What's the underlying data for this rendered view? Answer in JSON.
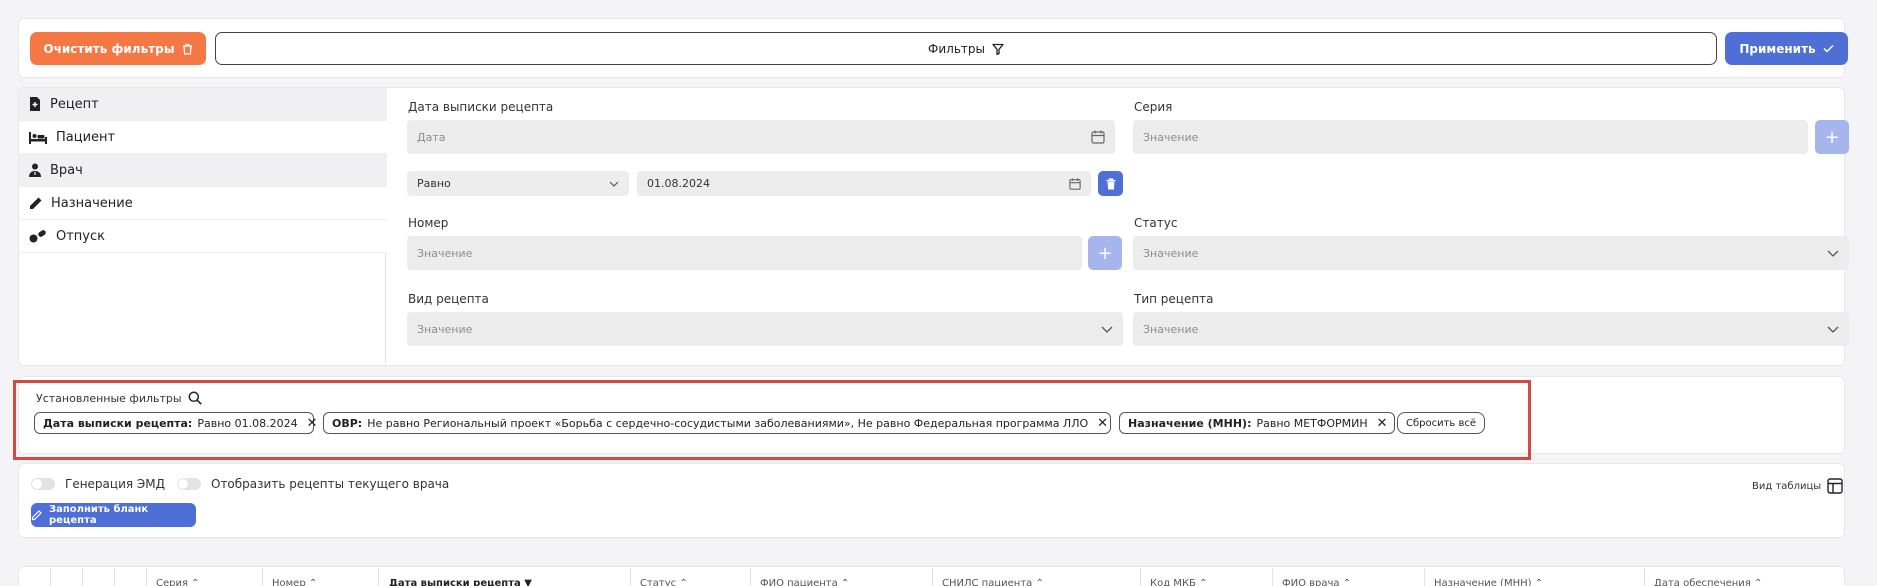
{
  "toolbar": {
    "clear_label": "Очистить фильтры",
    "filters_label": "Фильтры",
    "apply_label": "Применить"
  },
  "sidebar": {
    "items": [
      {
        "label": "Рецепт",
        "icon": "prescription-icon"
      },
      {
        "label": "Пациент",
        "icon": "patient-icon"
      },
      {
        "label": "Врач",
        "icon": "doctor-icon"
      },
      {
        "label": "Назначение",
        "icon": "pencil-icon"
      },
      {
        "label": "Отпуск",
        "icon": "pills-icon"
      }
    ]
  },
  "form": {
    "date_label": "Дата выписки рецепта",
    "date_placeholder": "Дата",
    "condition_value": "Равно",
    "date_value": "01.08.2024",
    "series_label": "Серия",
    "series_placeholder": "Значение",
    "number_label": "Номер",
    "number_placeholder": "Значение",
    "status_label": "Статус",
    "status_placeholder": "Значение",
    "kind_label": "Вид рецепта",
    "kind_placeholder": "Значение",
    "type_label": "Тип рецепта",
    "type_placeholder": "Значение"
  },
  "applied": {
    "title": "Установленные фильтры",
    "chips": [
      {
        "key": "Дата выписки рецепта:",
        "value": "Равно 01.08.2024"
      },
      {
        "key": "ОВР:",
        "value": "Не равно Региональный проект «Борьба с сердечно-сосудистыми заболеваниями», Не равно Федеральная программа ЛЛО"
      },
      {
        "key": "Назначение (МНН):",
        "value": "Равно МЕТФОРМИН"
      }
    ],
    "reset_label": "Сбросить всё"
  },
  "options": {
    "emd_label": "Генерация ЭМД",
    "current_doctor_label": "Отобразить рецепты текущего врача",
    "fill_form_label": "Заполнить бланк рецепта",
    "table_view_label": "Вид таблицы"
  },
  "table": {
    "headers": [
      "Серия",
      "Номер",
      "Дата выписки рецепта",
      "Статус",
      "ФИО пациента",
      "СНИЛС пациента",
      "Код МКБ",
      "ФИО врача",
      "Назначение (МНН)",
      "Дата обеспечения"
    ]
  },
  "colors": {
    "accent_orange": "#f47744",
    "accent_blue": "#4d6fd6",
    "highlight_red": "#d24b43"
  }
}
